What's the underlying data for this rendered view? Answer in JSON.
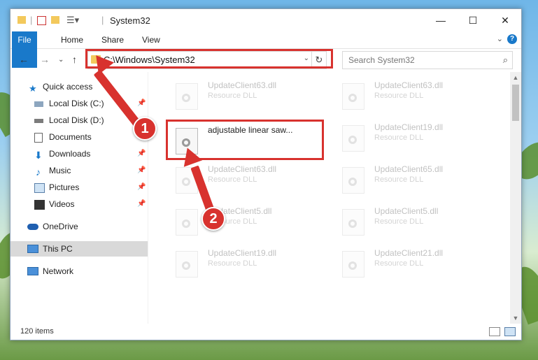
{
  "window": {
    "title": "System32"
  },
  "ribbon": {
    "tabs": [
      "File",
      "Home",
      "Share",
      "View"
    ]
  },
  "address": {
    "path": "C:\\Windows\\System32"
  },
  "search": {
    "placeholder": "Search System32"
  },
  "sidebar": {
    "items": [
      {
        "label": "Quick access",
        "icon": "star-icon"
      },
      {
        "label": "Local Disk (C:)",
        "icon": "drive-icon"
      },
      {
        "label": "Local Disk (D:)",
        "icon": "drive-icon"
      },
      {
        "label": "Documents",
        "icon": "document-icon"
      },
      {
        "label": "Downloads",
        "icon": "download-icon"
      },
      {
        "label": "Music",
        "icon": "music-icon"
      },
      {
        "label": "Pictures",
        "icon": "pictures-icon"
      },
      {
        "label": "Videos",
        "icon": "videos-icon"
      },
      {
        "label": "OneDrive",
        "icon": "cloud-icon"
      },
      {
        "label": "This PC",
        "icon": "computer-icon"
      },
      {
        "label": "Network",
        "icon": "network-icon"
      }
    ]
  },
  "files": [
    {
      "name": "UpdateClient63.dll",
      "type": "Resource DLL"
    },
    {
      "name": "UpdateClient63.dll",
      "type": "Resource DLL"
    },
    {
      "name": "adjustable linear saw...",
      "type": ""
    },
    {
      "name": "UpdateClient19.dll",
      "type": "Resource DLL"
    },
    {
      "name": "UpdateClient63.dll",
      "type": "Resource DLL"
    },
    {
      "name": "UpdateClient65.dll",
      "type": "Resource DLL"
    },
    {
      "name": "UpdateClient5.dll",
      "type": "Resource DLL"
    },
    {
      "name": "UpdateClient5.dll",
      "type": "Resource DLL"
    },
    {
      "name": "UpdateClient19.dll",
      "type": "Resource DLL"
    },
    {
      "name": "UpdateClient21.dll",
      "type": "Resource DLL"
    }
  ],
  "status": {
    "item_count": "120 items"
  },
  "annotations": {
    "step1": "1",
    "step2": "2"
  },
  "colors": {
    "accent": "#1979ca",
    "highlight": "#d8322e",
    "folder": "#f3c95c"
  }
}
